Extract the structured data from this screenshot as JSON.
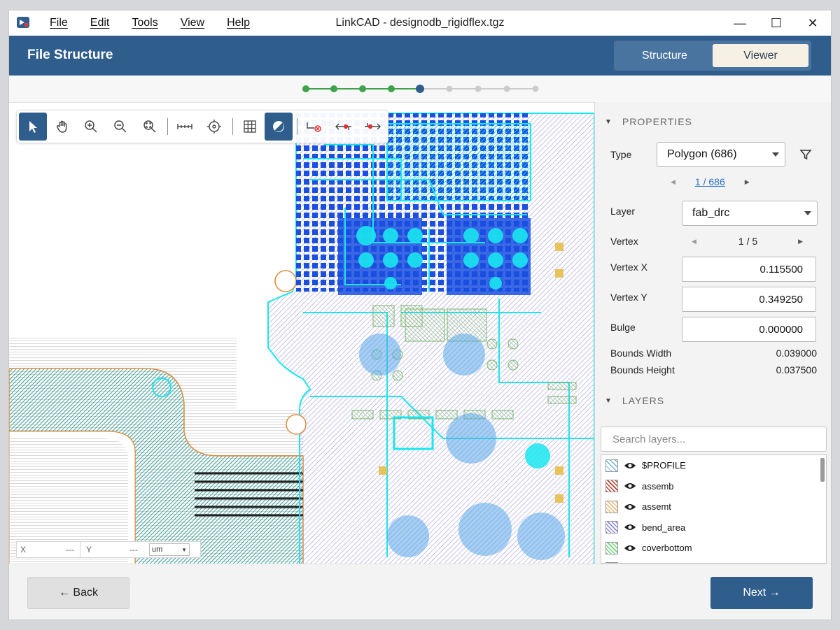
{
  "window": {
    "title": "LinkCAD - designodb_rigidflex.tgz",
    "minimize": "—",
    "maximize": "☐",
    "close": "✕"
  },
  "menu": [
    "File",
    "Edit",
    "Tools",
    "View",
    "Help"
  ],
  "header": {
    "title": "File Structure",
    "tabs": [
      {
        "label": "Structure",
        "active": false
      },
      {
        "label": "Viewer",
        "active": true
      }
    ]
  },
  "steps": {
    "total": 9,
    "completed": 4,
    "current_step": 5
  },
  "toolbar": {
    "tools": [
      "select-arrow-icon",
      "pan-hand-icon",
      "zoom-in-icon",
      "zoom-out-icon",
      "zoom-fit-icon",
      "measure-ruler-icon",
      "target-crosshair-icon",
      "grid-icon",
      "fill-contrast-icon",
      "clear-connection-icon",
      "trace-back-icon",
      "trace-forward-icon"
    ],
    "active_tools": [
      "select-arrow-icon",
      "fill-contrast-icon"
    ]
  },
  "coords": {
    "x_label": "X",
    "x_value": "---",
    "y_label": "Y",
    "y_value": "---",
    "unit": "um"
  },
  "properties": {
    "heading": "PROPERTIES",
    "type_label": "Type",
    "type_value": "Polygon (686)",
    "pager": "1 / 686",
    "layer_label": "Layer",
    "layer_value": "fab_drc",
    "vertex_label": "Vertex",
    "vertex_pager": "1 / 5",
    "vertex_x_label": "Vertex X",
    "vertex_x_value": "0.115500",
    "vertex_y_label": "Vertex Y",
    "vertex_y_value": "0.349250",
    "bulge_label": "Bulge",
    "bulge_value": "0.000000",
    "bounds_width_label": "Bounds Width",
    "bounds_width_value": "0.039000",
    "bounds_height_label": "Bounds Height",
    "bounds_height_value": "0.037500"
  },
  "layers": {
    "heading": "LAYERS",
    "search_placeholder": "Search layers...",
    "items": [
      {
        "name": "$PROFILE",
        "color": "#3a9fc0"
      },
      {
        "name": "assemb",
        "color": "#c0392b"
      },
      {
        "name": "assemt",
        "color": "#e8b77a"
      },
      {
        "name": "bend_area",
        "color": "#8a86d8"
      },
      {
        "name": "coverbottom",
        "color": "#6fd07a"
      },
      {
        "name": "",
        "color": "#bdbdbd"
      }
    ]
  },
  "footer": {
    "back_label": "← Back",
    "next_label": "Next →"
  },
  "colors": {
    "header_blue": "#2f5d8c",
    "step_done": "#3ea34a",
    "step_current": "#2f5d8c",
    "step_pending": "#cccccc",
    "pcb_blue": "#1a4fe0",
    "pcb_cyan": "#19e6f0",
    "pcb_teal": "#1aa69a",
    "pcb_lavender": "#b8b6e8"
  }
}
